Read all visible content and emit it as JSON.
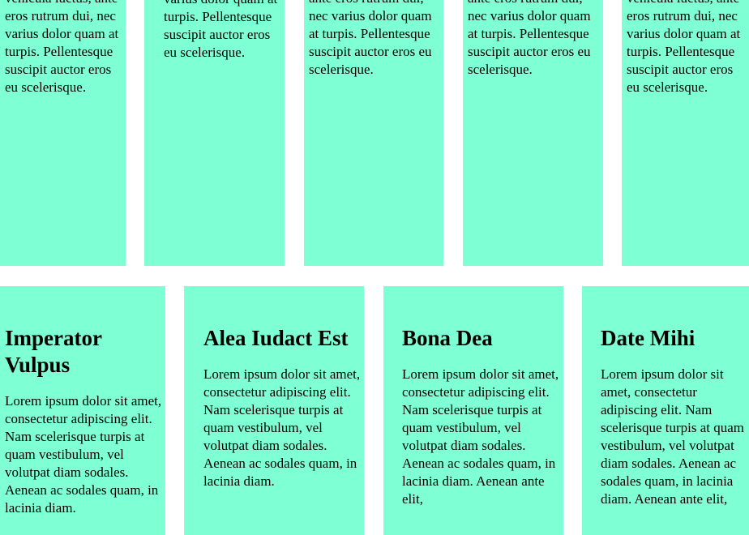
{
  "row1": {
    "cards": [
      {
        "text": "cursus ut diam. Vivamus semper, massa dapibus vehicula luctus, ante eros rutrum dui, nec varius dolor quam at turpis. Pellentesque suscipit auctor eros eu scelerisque."
      },
      {
        "text": "Vivamus semper, massa dapibus vehicula luctus, ante eros rutrum dui, nec varius dolor quam at turpis. Pellentesque suscipit auctor eros eu scelerisque."
      },
      {
        "text": "cursus ut diam. Vivamus semper, massa dapibus vehicula luctus, ante eros rutrum dui, nec varius dolor quam at turpis. Pellentesque suscipit auctor eros eu scelerisque."
      },
      {
        "text": "cursus ut diam. Vivamus semper, massa dapibus vehicula luctus, ante eros rutrum dui, nec varius dolor quam at turpis. Pellentesque suscipit auctor eros eu scelerisque."
      },
      {
        "text": "cursus ut diam. Vivamus semper, massa dapibus vehicula luctus, ante eros rutrum dui, nec varius dolor quam at turpis. Pellentesque suscipit auctor eros eu scelerisque."
      }
    ]
  },
  "row2": {
    "cards": [
      {
        "title": "Imperator Vulpus",
        "text": "Lorem ipsum dolor sit amet, consectetur adipiscing elit. Nam scelerisque turpis at quam vestibulum, vel volutpat diam sodales. Aenean ac sodales quam, in lacinia diam."
      },
      {
        "title": "Alea Iudact Est",
        "text": "Lorem ipsum dolor sit amet, consectetur adipiscing elit. Nam scelerisque turpis at quam vestibulum, vel volutpat diam sodales. Aenean ac sodales quam, in lacinia diam."
      },
      {
        "title": "Bona Dea",
        "text": "Lorem ipsum dolor sit amet, consectetur adipiscing elit. Nam scelerisque turpis at quam vestibulum, vel volutpat diam sodales. Aenean ac sodales quam, in lacinia diam. Aenean ante elit,"
      },
      {
        "title": "Date Mihi",
        "text": "Lorem ipsum dolor sit amet, consectetur adipiscing elit. Nam scelerisque turpis at quam vestibulum, vel volutpat diam sodales. Aenean ac sodales quam, in lacinia diam. Aenean ante elit,"
      }
    ]
  },
  "colors": {
    "card_background": "#7fffd4",
    "page_background": "#ffffff",
    "text": "#000000"
  }
}
